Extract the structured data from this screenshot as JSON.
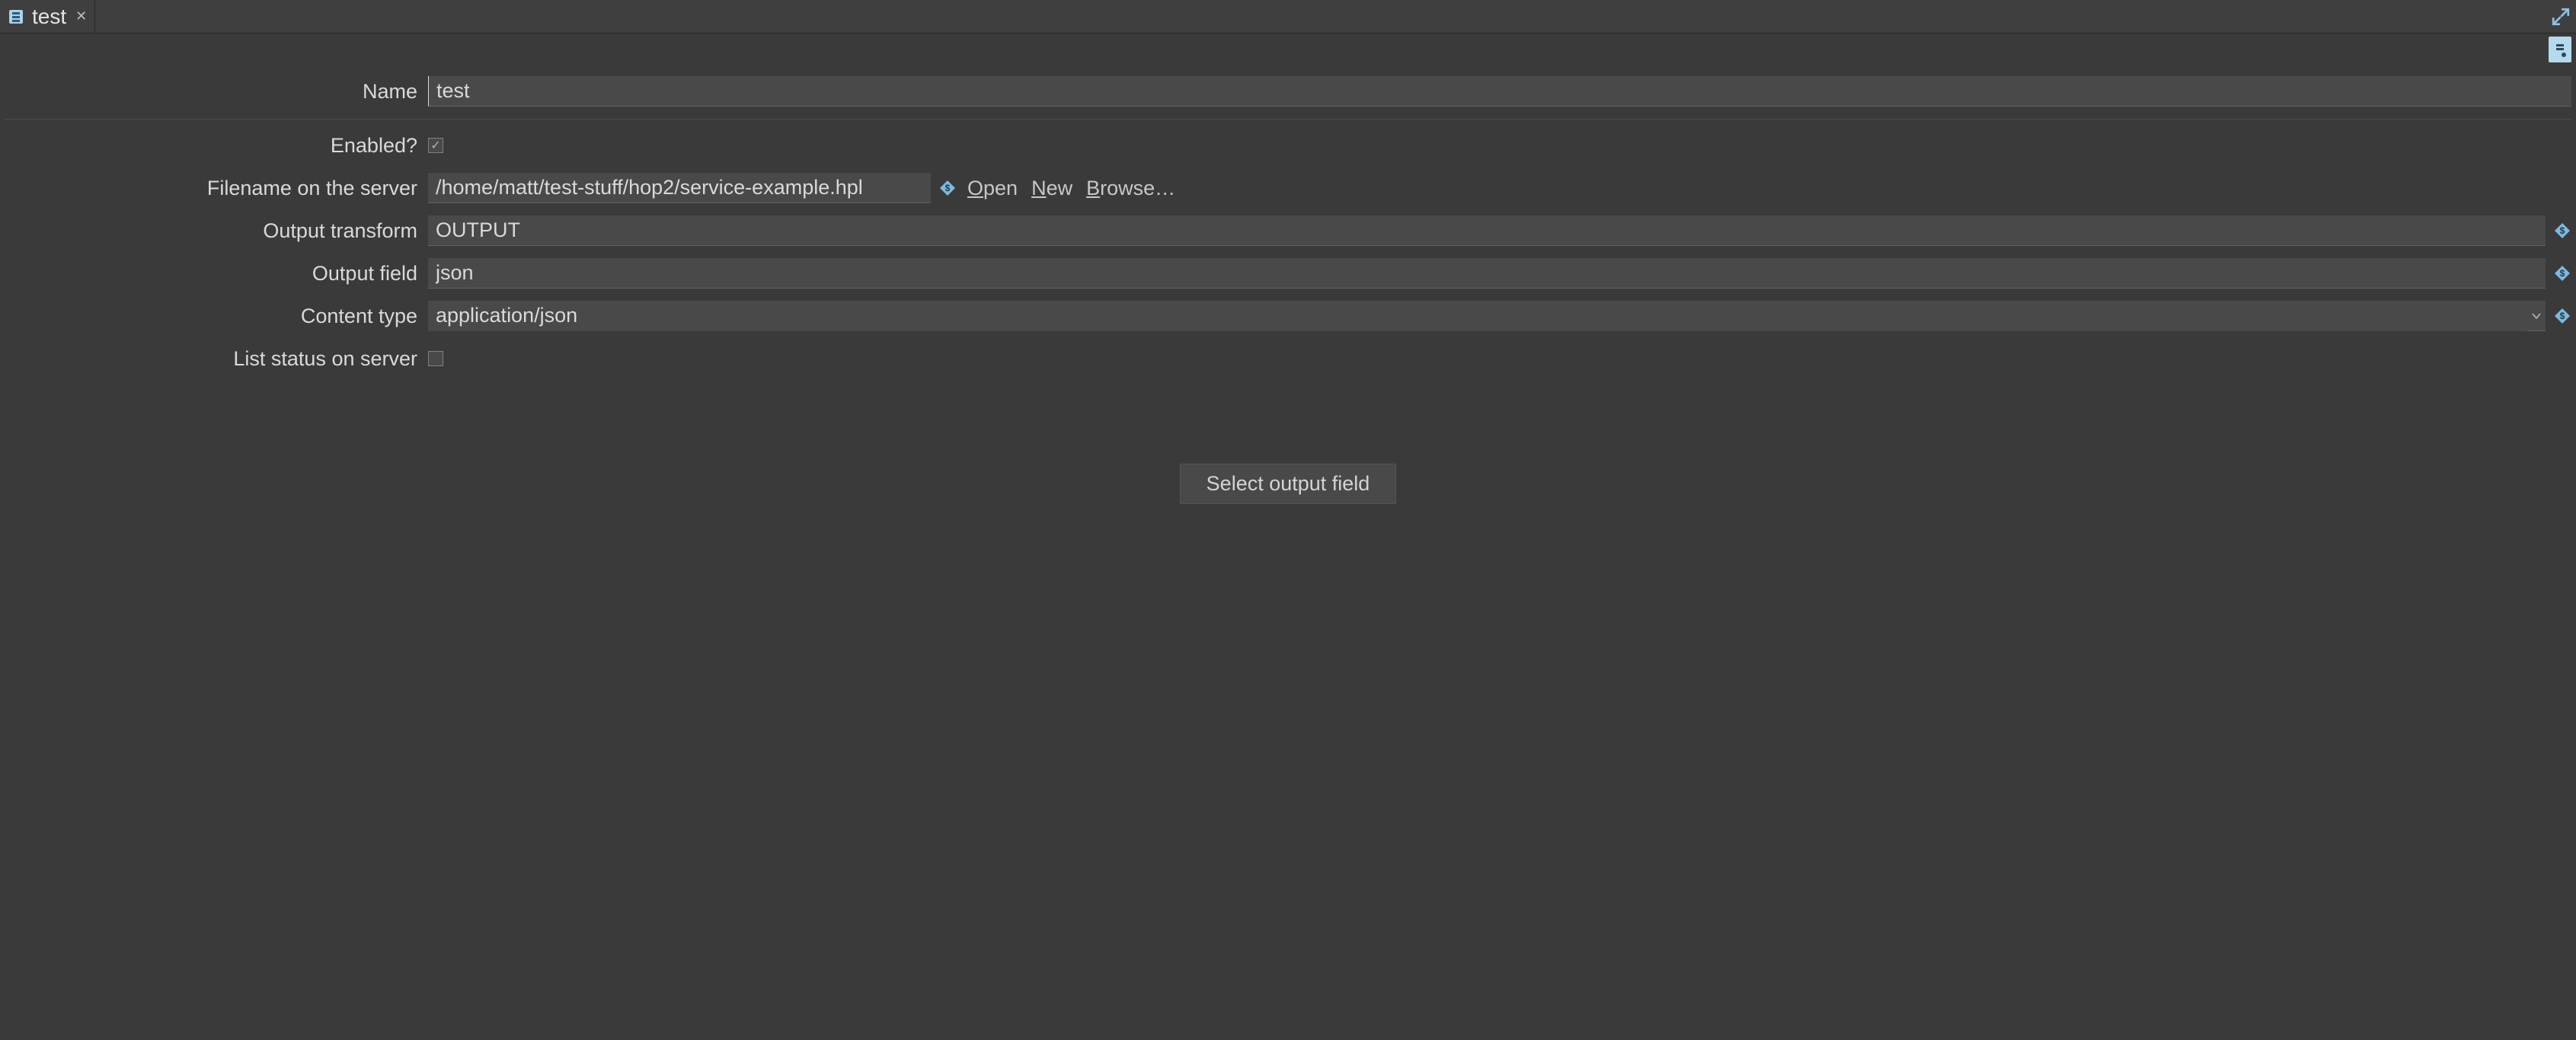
{
  "tab": {
    "title": "test"
  },
  "form": {
    "name": {
      "label": "Name",
      "value": "test"
    },
    "enabled": {
      "label": "Enabled?",
      "checked": true
    },
    "filename": {
      "label": "Filename on the server",
      "value": "/home/matt/test-stuff/hop2/service-example.hpl"
    },
    "output_transform": {
      "label": "Output transform",
      "value": "OUTPUT"
    },
    "output_field": {
      "label": "Output field",
      "value": "json"
    },
    "content_type": {
      "label": "Content type",
      "value": "application/json"
    },
    "list_status": {
      "label": "List status on server",
      "checked": false
    }
  },
  "buttons": {
    "open": "Open",
    "new": "New",
    "browse": "Browse…",
    "select_output_field": "Select output field"
  }
}
